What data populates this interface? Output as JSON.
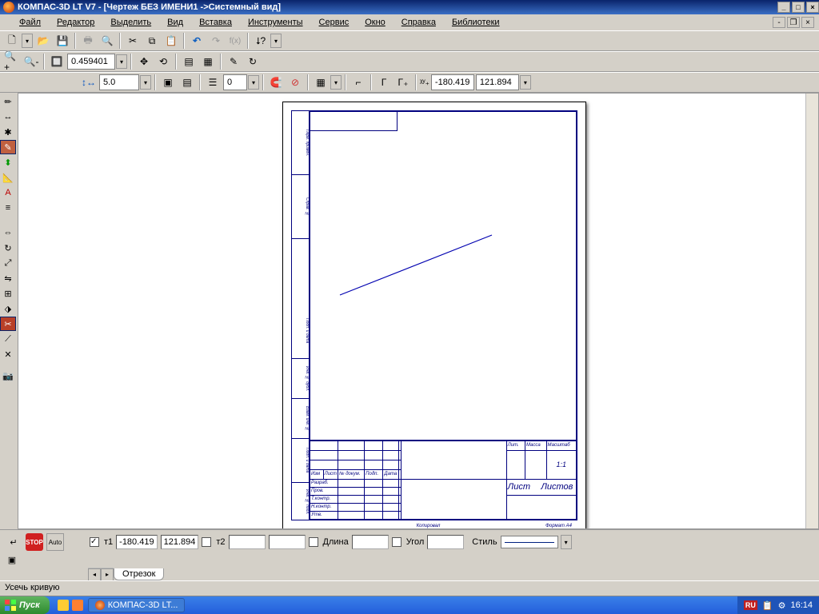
{
  "title": "КОМПАС-3D LT V7 - [Чертеж БЕЗ ИМЕНИ1 ->Системный вид]",
  "menu": [
    "Файл",
    "Редактор",
    "Выделить",
    "Вид",
    "Вставка",
    "Инструменты",
    "Сервис",
    "Окно",
    "Справка",
    "Библиотеки"
  ],
  "zoom_value": "0.459401",
  "scale_value": "5.0",
  "cx_value": "-180.419",
  "cy_value": "121.894",
  "tab_name": "Отрезок",
  "t1_label": "т1",
  "t2_label": "т2",
  "t1_x": "-180.419",
  "t1_y": "121.894",
  "t2_x": "",
  "t2_y": "",
  "length_label": "Длина",
  "length_val": "",
  "angle_label": "Угол",
  "angle_val": "",
  "style_label": "Стиль",
  "status_text": "Усечь кривую",
  "start_label": "Пуск",
  "task_app": "КОМПАС-3D LT...",
  "lang": "RU",
  "clock": "16:14",
  "titleblock": {
    "r1": [
      "Изм",
      "Лист",
      "№ докум.",
      "Подп.",
      "Дата"
    ],
    "r2": "Разраб.",
    "r3": "Пров.",
    "r4": "Т.контр.",
    "r5": "Н.контр.",
    "r6": "Утв.",
    "lit": "Лит.",
    "massa": "Масса",
    "scale": "Масштаб",
    "scale_val": "1:1",
    "list": "Лист",
    "listov": "Листов",
    "kopiroval": "Копировал",
    "format": "Формат   А4"
  }
}
